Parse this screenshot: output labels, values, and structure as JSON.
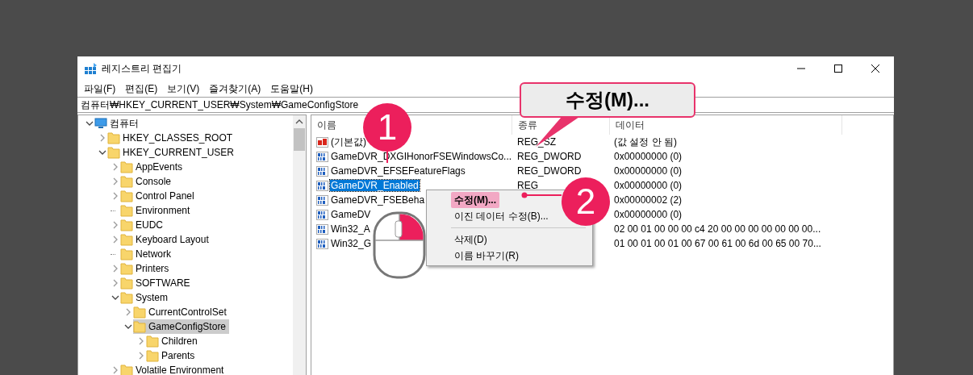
{
  "window": {
    "title": "레지스트리 편집기"
  },
  "menu": [
    "파일(F)",
    "편집(E)",
    "보기(V)",
    "즐겨찾기(A)",
    "도움말(H)"
  ],
  "address": "컴퓨터₩HKEY_CURRENT_USER₩System₩GameConfigStore",
  "tree": [
    {
      "label": "컴퓨터",
      "kind": "computer",
      "expandable": true,
      "expanded": true,
      "selected": false,
      "children": [
        {
          "label": "HKEY_CLASSES_ROOT",
          "kind": "folder",
          "expandable": true,
          "expanded": false,
          "selected": false
        },
        {
          "label": "HKEY_CURRENT_USER",
          "kind": "folder",
          "expandable": true,
          "expanded": true,
          "selected": false,
          "children": [
            {
              "label": "AppEvents",
              "kind": "folder",
              "expandable": true,
              "expanded": false,
              "selected": false
            },
            {
              "label": "Console",
              "kind": "folder",
              "expandable": true,
              "expanded": false,
              "selected": false
            },
            {
              "label": "Control Panel",
              "kind": "folder",
              "expandable": true,
              "expanded": false,
              "selected": false
            },
            {
              "label": "Environment",
              "kind": "folder",
              "expandable": false,
              "expanded": false,
              "selected": false
            },
            {
              "label": "EUDC",
              "kind": "folder",
              "expandable": true,
              "expanded": false,
              "selected": false
            },
            {
              "label": "Keyboard Layout",
              "kind": "folder",
              "expandable": true,
              "expanded": false,
              "selected": false
            },
            {
              "label": "Network",
              "kind": "folder",
              "expandable": false,
              "expanded": false,
              "selected": false
            },
            {
              "label": "Printers",
              "kind": "folder",
              "expandable": true,
              "expanded": false,
              "selected": false
            },
            {
              "label": "SOFTWARE",
              "kind": "folder",
              "expandable": true,
              "expanded": false,
              "selected": false
            },
            {
              "label": "System",
              "kind": "folder",
              "expandable": true,
              "expanded": true,
              "selected": false,
              "children": [
                {
                  "label": "CurrentControlSet",
                  "kind": "folder",
                  "expandable": true,
                  "expanded": false,
                  "selected": false
                },
                {
                  "label": "GameConfigStore",
                  "kind": "folder",
                  "expandable": true,
                  "expanded": true,
                  "selected": true,
                  "children": [
                    {
                      "label": "Children",
                      "kind": "folder",
                      "expandable": true,
                      "expanded": false,
                      "selected": false
                    },
                    {
                      "label": "Parents",
                      "kind": "folder",
                      "expandable": true,
                      "expanded": false,
                      "selected": false
                    }
                  ]
                }
              ]
            },
            {
              "label": "Volatile Environment",
              "kind": "folder",
              "expandable": true,
              "expanded": false,
              "selected": false
            }
          ]
        }
      ]
    }
  ],
  "values": {
    "columns": [
      "이름",
      "종류",
      "데이터"
    ],
    "rows": [
      {
        "kind": "string",
        "name": "(기본값)",
        "type": "REG_SZ",
        "data": "(값 설정 안 됨)",
        "selected": false
      },
      {
        "kind": "binary",
        "name": "GameDVR_DXGIHonorFSEWindowsCo...",
        "type": "REG_DWORD",
        "data": "0x00000000 (0)",
        "selected": false
      },
      {
        "kind": "binary",
        "name": "GameDVR_EFSEFeatureFlags",
        "type": "REG_DWORD",
        "data": "0x00000000 (0)",
        "selected": false
      },
      {
        "kind": "binary",
        "name": "GameDVR_Enabled",
        "type": "REG",
        "data": "0x00000000 (0)",
        "selected": true
      },
      {
        "kind": "binary",
        "name": "GameDVR_FSEBeha",
        "data": "0x00000002 (2)",
        "selected": false
      },
      {
        "kind": "binary",
        "name": "GameDV",
        "data": "0x00000000 (0)",
        "selected": false
      },
      {
        "kind": "binary",
        "name": "Win32_A",
        "data": "02 00 01 00 00 00 c4 20 00 00 00 00 00 00 00...",
        "selected": false
      },
      {
        "kind": "binary",
        "name": "Win32_G",
        "data": "01 00 01 00 01 00 67 00 61 00 6d 00 65 00 70...",
        "selected": false
      }
    ]
  },
  "context_menu": [
    {
      "kind": "item",
      "label": "수정(M)...",
      "selected": true
    },
    {
      "kind": "item",
      "label": "이진 데이터 수정(B)...",
      "selected": false
    },
    {
      "kind": "separator"
    },
    {
      "kind": "item",
      "label": "삭제(D)",
      "selected": false
    },
    {
      "kind": "item",
      "label": "이름 바꾸기(R)",
      "selected": false
    }
  ],
  "annotations": [
    {
      "kind": "callout",
      "text": "수정(M)..."
    },
    {
      "kind": "step",
      "text": "1"
    },
    {
      "kind": "step",
      "text": "2"
    },
    {
      "kind": "mouse"
    }
  ]
}
